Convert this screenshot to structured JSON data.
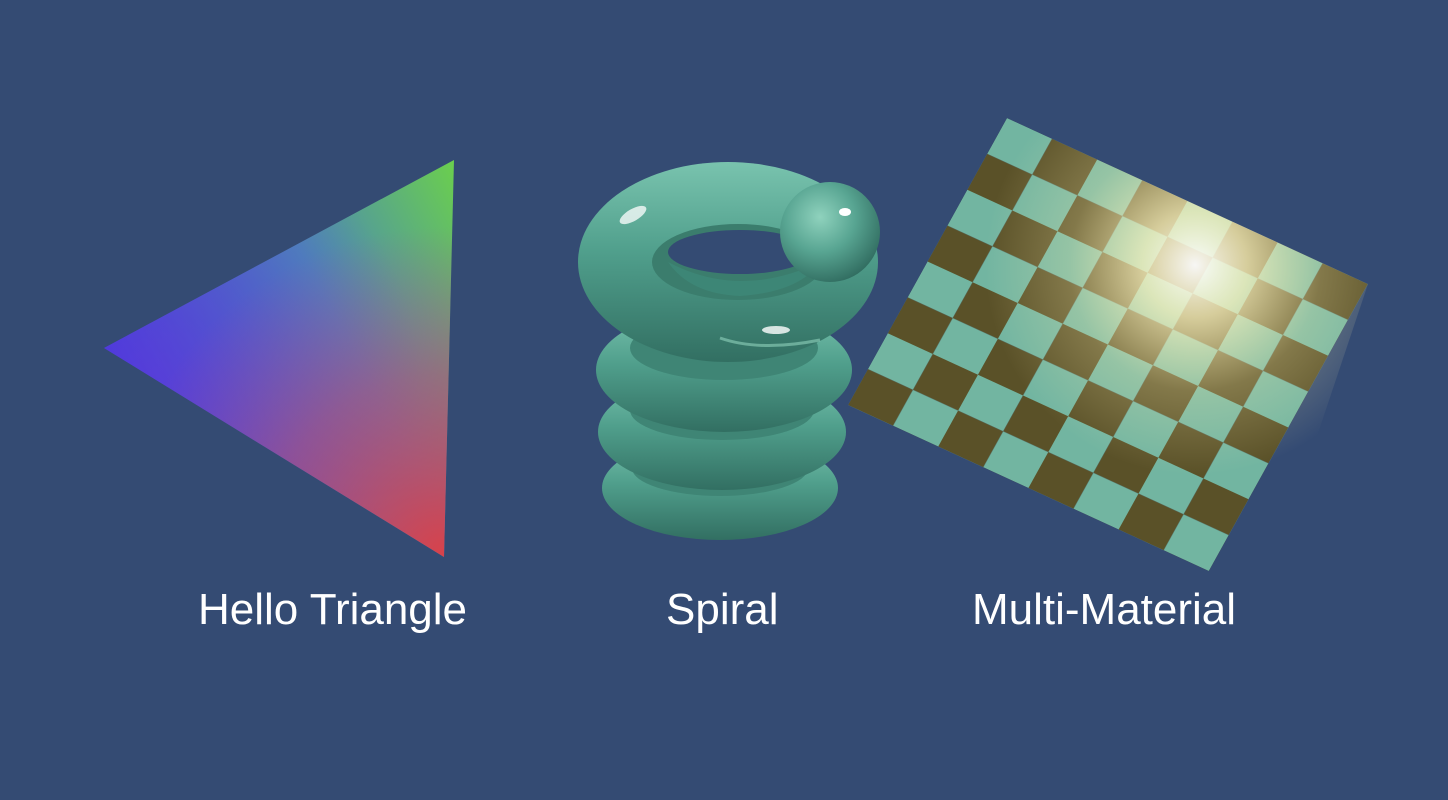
{
  "scene": {
    "background": "#344b73",
    "captions": {
      "triangle": "Hello Triangle",
      "spiral": "Spiral",
      "multi_material": "Multi-Material"
    },
    "triangle_vertex_colors": {
      "left": "#3d3ae0",
      "top_right": "#6bcf4d",
      "bottom_right": "#d8424a"
    },
    "spiral_color": "#4e9c8a",
    "checker_colors": {
      "light": "#72b5a1",
      "dark": "#5a5128",
      "highlight": "#fff7c8"
    }
  }
}
